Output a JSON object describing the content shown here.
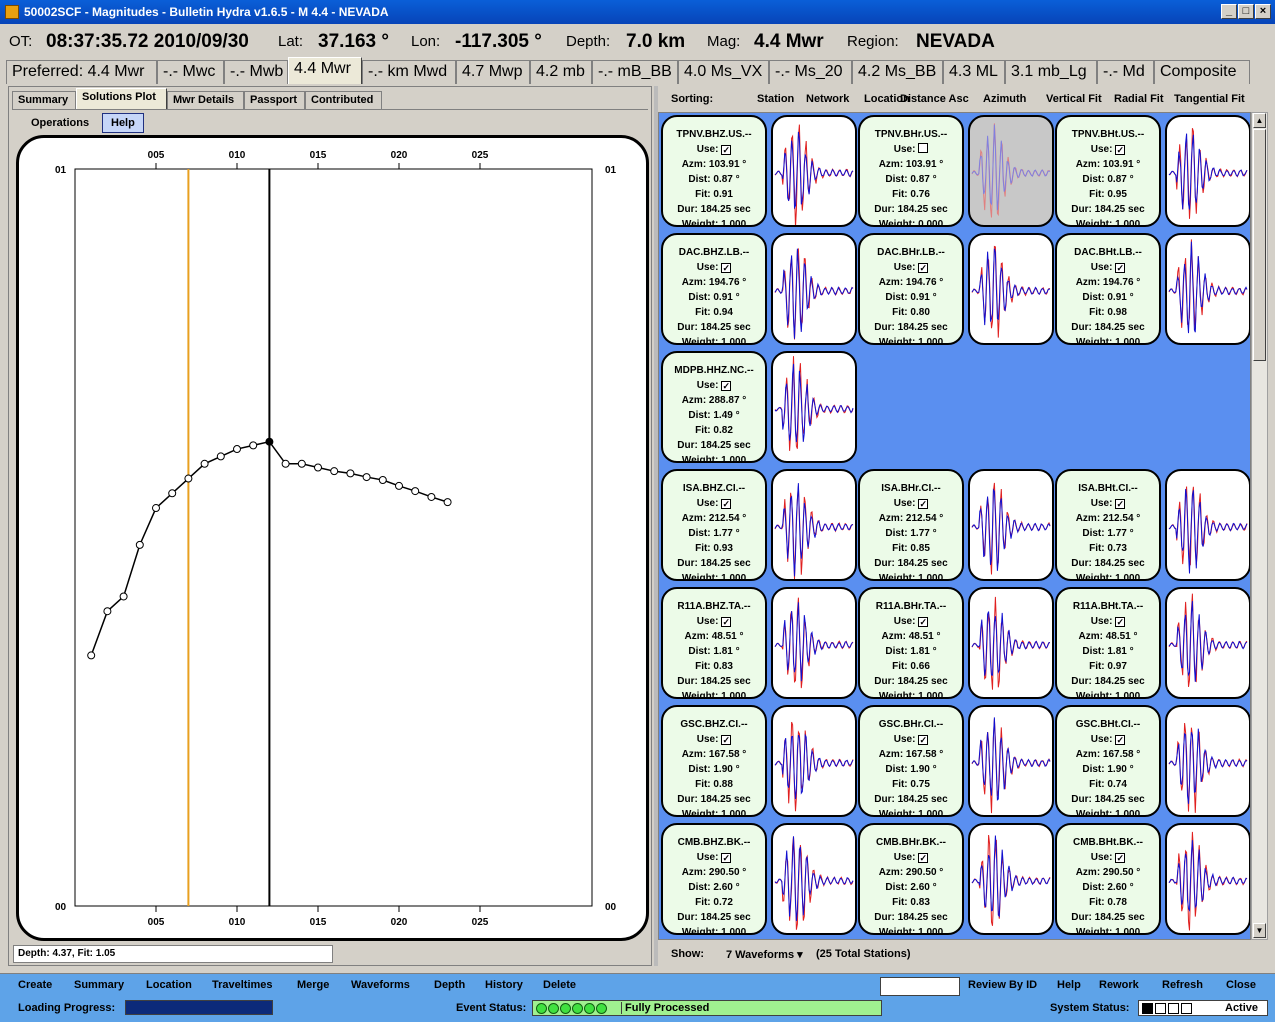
{
  "window": {
    "title": "50002SCF - Magnitudes - Bulletin Hydra v1.6.5 -  M 4.4  - NEVADA"
  },
  "event": {
    "ot_label": "OT:",
    "ot": "08:37:35.72 2010/09/30",
    "lat_label": "Lat:",
    "lat": "37.163 °",
    "lon_label": "Lon:",
    "lon": "-117.305 °",
    "depth_label": "Depth:",
    "depth": "7.0 km",
    "mag_label": "Mag:",
    "mag": "4.4 Mwr",
    "region_label": "Region:",
    "region": "NEVADA"
  },
  "mag_tabs": [
    "Preferred: 4.4 Mwr",
    "-.- Mwc",
    "-.- Mwb",
    "4.4 Mwr",
    "-.- km Mwd",
    "4.7 Mwp",
    "4.2 mb",
    "-.- mB_BB",
    "4.0 Ms_VX",
    "-.- Ms_20",
    "4.2 Ms_BB",
    "4.3 ML",
    "3.1 mb_Lg",
    "-.- Md",
    "Composite"
  ],
  "mag_tab_selected": 3,
  "subtabs": [
    "Summary",
    "Solutions Plot",
    "Mwr Details",
    "Passport",
    "Contributed"
  ],
  "subtab_selected": 1,
  "plot_buttons": {
    "operations": "Operations",
    "help": "Help"
  },
  "plot": {
    "x_ticks": [
      "005",
      "010",
      "015",
      "020",
      "025"
    ],
    "y_top": "01",
    "y_bottom": "00",
    "orange_line_x": 7,
    "best_depth": 12,
    "points": [
      [
        1,
        0.34
      ],
      [
        2,
        0.4
      ],
      [
        3,
        0.42
      ],
      [
        4,
        0.49
      ],
      [
        5,
        0.54
      ],
      [
        6,
        0.56
      ],
      [
        7,
        0.58
      ],
      [
        8,
        0.6
      ],
      [
        9,
        0.61
      ],
      [
        10,
        0.62
      ],
      [
        11,
        0.625
      ],
      [
        12,
        0.63
      ],
      [
        13,
        0.6
      ],
      [
        14,
        0.6
      ],
      [
        15,
        0.595
      ],
      [
        16,
        0.59
      ],
      [
        17,
        0.587
      ],
      [
        18,
        0.582
      ],
      [
        19,
        0.578
      ],
      [
        20,
        0.57
      ],
      [
        21,
        0.563
      ],
      [
        22,
        0.555
      ],
      [
        23,
        0.548
      ]
    ]
  },
  "status_line": "Depth: 4.37, Fit: 1.05",
  "sort": {
    "label": "Sorting:",
    "options": [
      "Station",
      "Network",
      "Location",
      "Distance Asc",
      "Azimuth",
      "Vertical Fit",
      "Radial Fit",
      "Tangential Fit"
    ]
  },
  "stations": [
    {
      "row": 0,
      "cards": [
        {
          "name": "TPNV.BHZ.US.--",
          "use": true,
          "azm": "Azm: 103.91 °",
          "dist": "Dist: 0.87 °",
          "fit": "Fit: 0.91",
          "dur": "Dur: 184.25 sec",
          "weight": "Weight: 1.000",
          "gray": false
        },
        {
          "name": "TPNV.BHr.US.--",
          "use": false,
          "azm": "Azm: 103.91 °",
          "dist": "Dist: 0.87 °",
          "fit": "Fit: 0.76",
          "dur": "Dur: 184.25 sec",
          "weight": "Weight: 0.000",
          "gray": true
        },
        {
          "name": "TPNV.BHt.US.--",
          "use": true,
          "azm": "Azm: 103.91 °",
          "dist": "Dist: 0.87 °",
          "fit": "Fit: 0.95",
          "dur": "Dur: 184.25 sec",
          "weight": "Weight: 1.000",
          "gray": false
        }
      ]
    },
    {
      "row": 1,
      "cards": [
        {
          "name": "DAC.BHZ.LB.--",
          "use": true,
          "azm": "Azm: 194.76 °",
          "dist": "Dist: 0.91 °",
          "fit": "Fit: 0.94",
          "dur": "Dur: 184.25 sec",
          "weight": "Weight: 1.000",
          "gray": false
        },
        {
          "name": "DAC.BHr.LB.--",
          "use": true,
          "azm": "Azm: 194.76 °",
          "dist": "Dist: 0.91 °",
          "fit": "Fit: 0.80",
          "dur": "Dur: 184.25 sec",
          "weight": "Weight: 1.000",
          "gray": false
        },
        {
          "name": "DAC.BHt.LB.--",
          "use": true,
          "azm": "Azm: 194.76 °",
          "dist": "Dist: 0.91 °",
          "fit": "Fit: 0.98",
          "dur": "Dur: 184.25 sec",
          "weight": "Weight: 1.000",
          "gray": false
        }
      ]
    },
    {
      "row": 2,
      "cards": [
        {
          "name": "MDPB.HHZ.NC.--",
          "use": true,
          "azm": "Azm: 288.87 °",
          "dist": "Dist: 1.49 °",
          "fit": "Fit: 0.82",
          "dur": "Dur: 184.25 sec",
          "weight": "Weight: 1.000",
          "gray": false
        }
      ]
    },
    {
      "row": 3,
      "cards": [
        {
          "name": "ISA.BHZ.CI.--",
          "use": true,
          "azm": "Azm: 212.54 °",
          "dist": "Dist: 1.77 °",
          "fit": "Fit: 0.93",
          "dur": "Dur: 184.25 sec",
          "weight": "Weight: 1.000",
          "gray": false
        },
        {
          "name": "ISA.BHr.CI.--",
          "use": true,
          "azm": "Azm: 212.54 °",
          "dist": "Dist: 1.77 °",
          "fit": "Fit: 0.85",
          "dur": "Dur: 184.25 sec",
          "weight": "Weight: 1.000",
          "gray": false
        },
        {
          "name": "ISA.BHt.CI.--",
          "use": true,
          "azm": "Azm: 212.54 °",
          "dist": "Dist: 1.77 °",
          "fit": "Fit: 0.73",
          "dur": "Dur: 184.25 sec",
          "weight": "Weight: 1.000",
          "gray": false
        }
      ]
    },
    {
      "row": 4,
      "cards": [
        {
          "name": "R11A.BHZ.TA.--",
          "use": true,
          "azm": "Azm: 48.51 °",
          "dist": "Dist: 1.81 °",
          "fit": "Fit: 0.83",
          "dur": "Dur: 184.25 sec",
          "weight": "Weight: 1.000",
          "gray": false
        },
        {
          "name": "R11A.BHr.TA.--",
          "use": true,
          "azm": "Azm: 48.51 °",
          "dist": "Dist: 1.81 °",
          "fit": "Fit: 0.66",
          "dur": "Dur: 184.25 sec",
          "weight": "Weight: 1.000",
          "gray": false
        },
        {
          "name": "R11A.BHt.TA.--",
          "use": true,
          "azm": "Azm: 48.51 °",
          "dist": "Dist: 1.81 °",
          "fit": "Fit: 0.97",
          "dur": "Dur: 184.25 sec",
          "weight": "Weight: 1.000",
          "gray": false
        }
      ]
    },
    {
      "row": 5,
      "cards": [
        {
          "name": "GSC.BHZ.CI.--",
          "use": true,
          "azm": "Azm: 167.58 °",
          "dist": "Dist: 1.90 °",
          "fit": "Fit: 0.88",
          "dur": "Dur: 184.25 sec",
          "weight": "Weight: 1.000",
          "gray": false
        },
        {
          "name": "GSC.BHr.CI.--",
          "use": true,
          "azm": "Azm: 167.58 °",
          "dist": "Dist: 1.90 °",
          "fit": "Fit: 0.75",
          "dur": "Dur: 184.25 sec",
          "weight": "Weight: 1.000",
          "gray": false
        },
        {
          "name": "GSC.BHt.CI.--",
          "use": true,
          "azm": "Azm: 167.58 °",
          "dist": "Dist: 1.90 °",
          "fit": "Fit: 0.74",
          "dur": "Dur: 184.25 sec",
          "weight": "Weight: 1.000",
          "gray": false
        }
      ]
    },
    {
      "row": 6,
      "cards": [
        {
          "name": "CMB.BHZ.BK.--",
          "use": true,
          "azm": "Azm: 290.50 °",
          "dist": "Dist: 2.60 °",
          "fit": "Fit: 0.72",
          "dur": "Dur: 184.25 sec",
          "weight": "Weight: 1.000",
          "gray": false
        },
        {
          "name": "CMB.BHr.BK.--",
          "use": true,
          "azm": "Azm: 290.50 °",
          "dist": "Dist: 2.60 °",
          "fit": "Fit: 0.83",
          "dur": "Dur: 184.25 sec",
          "weight": "Weight: 1.000",
          "gray": false
        },
        {
          "name": "CMB.BHt.BK.--",
          "use": true,
          "azm": "Azm: 290.50 °",
          "dist": "Dist: 2.60 °",
          "fit": "Fit: 0.78",
          "dur": "Dur: 184.25 sec",
          "weight": "Weight: 1.000",
          "gray": false
        }
      ]
    }
  ],
  "use_label": "Use:",
  "show": {
    "label": "Show:",
    "value": "7 Waveforms",
    "total": "(25 Total Stations)"
  },
  "menu": [
    "Create",
    "Summary",
    "Location",
    "Traveltimes",
    "Merge",
    "Waveforms",
    "Depth",
    "History",
    "Delete"
  ],
  "menu_right": [
    "Review By ID",
    "Help",
    "Rework",
    "Refresh",
    "Close"
  ],
  "status": {
    "loading_label": "Loading Progress:",
    "event_label": "Event Status:",
    "event_value": "Fully Processed",
    "system_label": "System Status:",
    "system_value": "Active"
  },
  "colors": {
    "accent": "#0a5fd8",
    "grid_bg": "#5a8ff0",
    "info_card": "#ecfbe8",
    "trace_red": "#e02020",
    "trace_blue": "#1010d0",
    "orange": "#e8a020"
  }
}
